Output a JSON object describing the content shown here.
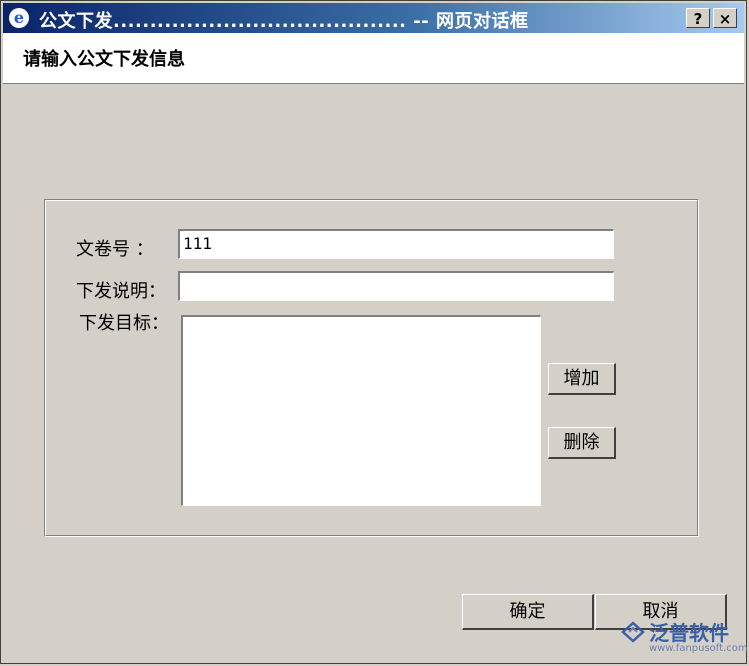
{
  "window": {
    "title": "公文下发........................................ -- 网页对话框",
    "help_label": "?",
    "close_label": "×"
  },
  "header": {
    "title": "请输入公文下发信息"
  },
  "form": {
    "doc_number_label": "文卷号  ：",
    "doc_number_value": "111",
    "description_label": "下发说明：",
    "description_value": "",
    "target_label": "下发目标：",
    "add_label": "增加",
    "delete_label": "删除"
  },
  "footer": {
    "confirm_label": "确定",
    "cancel_label": "取消"
  },
  "watermark": {
    "brand": "泛普软件",
    "url": "www.fanpusoft.com"
  },
  "colors": {
    "titlebar_start": "#0a246a",
    "titlebar_end": "#a6caf0",
    "dialog_bg": "#d4d0c8",
    "watermark": "#3b5fa8"
  }
}
